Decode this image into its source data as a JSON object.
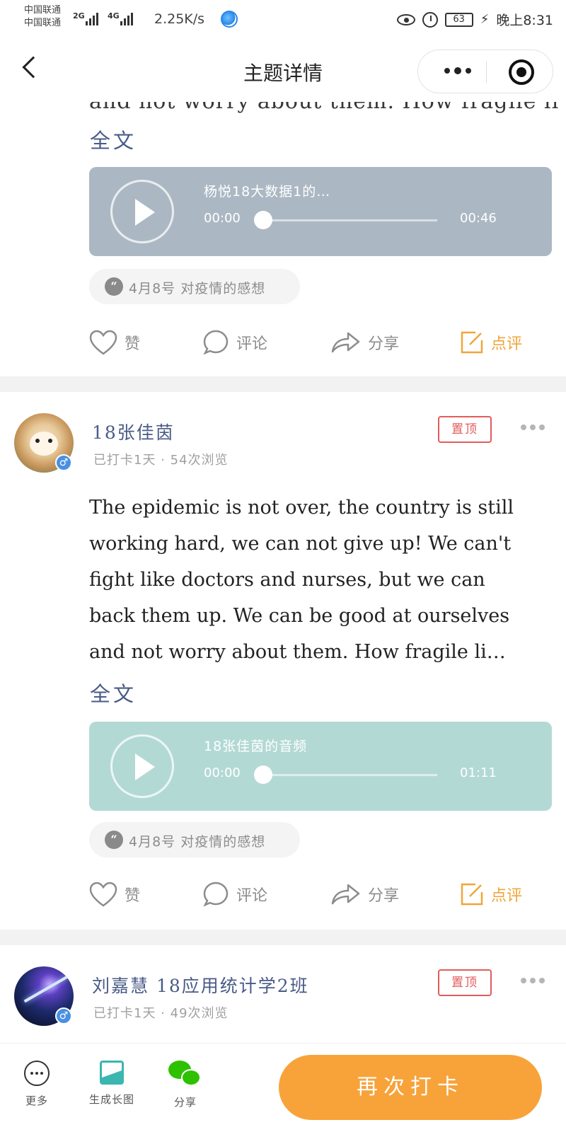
{
  "status_bar": {
    "carrier_1": "中国联通",
    "carrier_2": "中国联通",
    "sig1": "2G",
    "sig2": "4G",
    "speed": "2.25K/s",
    "battery": "63",
    "time": "晚上8:31"
  },
  "nav": {
    "title": "主题详情"
  },
  "post_top": {
    "cut_text": "and not worry about them. How fragile li",
    "fulltext_label": "全文",
    "audio": {
      "title": "杨悦18大数据1的…",
      "time_start": "00:00",
      "time_end": "00:46",
      "bg_color": "#abb8c3"
    },
    "tag": "4月8号 对疫情的感想",
    "actions": {
      "like": "赞",
      "comment": "评论",
      "share": "分享",
      "review": "点评"
    }
  },
  "post_1": {
    "username": "18张佳茵",
    "meta": "已打卡1天 · 54次浏览",
    "pin": "置顶",
    "gender": "♂",
    "lines": [
      "The epidemic is not over, the country is still",
      "working hard, we can not give up! We can't",
      "fight like doctors and nurses, but we can",
      "back them up. We can be good at ourselves",
      "and not worry about them. How fragile li…"
    ],
    "fulltext_label": "全文",
    "audio": {
      "title": "18张佳茵的音频",
      "time_start": "00:00",
      "time_end": "01:11",
      "bg_color": "#b3d9d5"
    },
    "tag": "4月8号 对疫情的感想",
    "actions": {
      "like": "赞",
      "comment": "评论",
      "share": "分享",
      "review": "点评"
    }
  },
  "post_2": {
    "username": "刘嘉慧 18应用统计学2班",
    "meta": "已打卡1天 · 49次浏览",
    "pin": "置顶",
    "gender": "♂"
  },
  "bottom_bar": {
    "more": "更多",
    "generate_image": "生成长图",
    "share": "分享",
    "checkin_again": "再次打卡"
  },
  "colors": {
    "accent_orange": "#f7a33a",
    "name_blue": "#4a5b86",
    "pin_red": "#e25b5b"
  }
}
